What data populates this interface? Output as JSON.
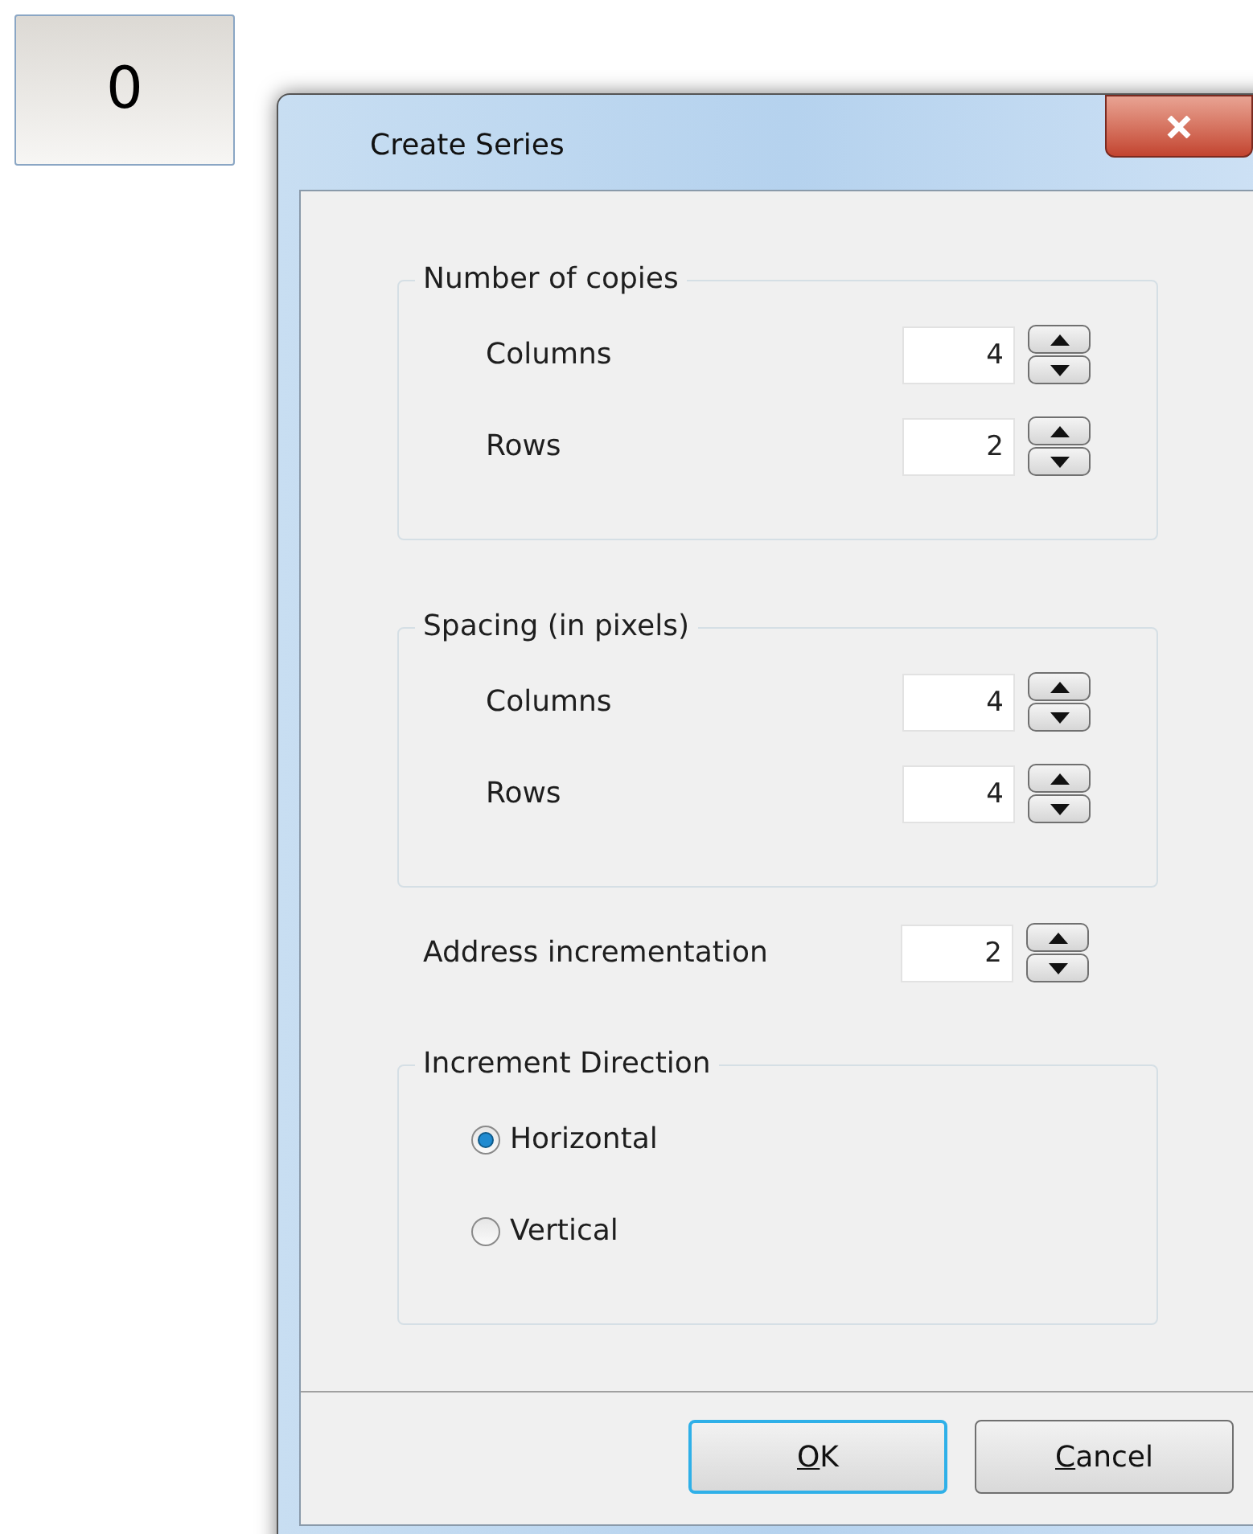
{
  "counter_button": {
    "label": "0"
  },
  "window": {
    "title": "Create Series"
  },
  "groups": [
    {
      "title": "Number of copies",
      "fields": [
        {
          "label": "Columns",
          "value": "4"
        },
        {
          "label": "Rows",
          "value": "2"
        }
      ]
    },
    {
      "title": "Spacing (in pixels)",
      "fields": [
        {
          "label": "Columns",
          "value": "4"
        },
        {
          "label": "Rows",
          "value": "4"
        }
      ]
    }
  ],
  "address_incrementation": {
    "label": "Address incrementation",
    "value": "2"
  },
  "direction": {
    "title": "Increment Direction",
    "options": [
      {
        "label": "Horizontal",
        "selected": true
      },
      {
        "label": "Vertical",
        "selected": false
      }
    ]
  },
  "buttons": [
    {
      "label": "OK",
      "focused": true
    },
    {
      "label": "Cancel",
      "focused": false
    }
  ]
}
